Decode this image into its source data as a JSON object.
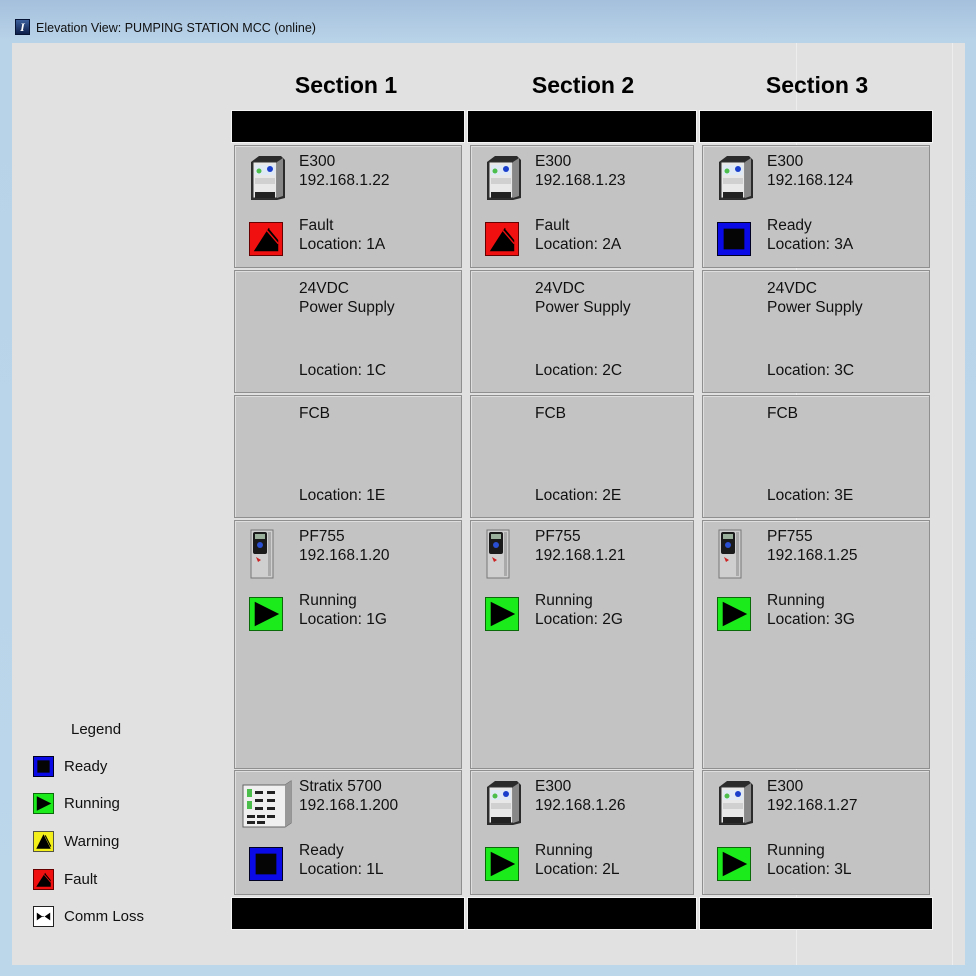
{
  "window": {
    "title": "Elevation View: PUMPING STATION MCC (online)",
    "app_icon": "factorytalk-icon"
  },
  "colors": {
    "fault": "#f01010",
    "ready": "#0a0ae6",
    "running": "#1bea1b",
    "warning": "#f2ef1a",
    "comm_loss": "#ffffff",
    "cell_bg": "#c3c3c3",
    "panel_bg": "#e1e1e1"
  },
  "sections": [
    {
      "title": "Section 1",
      "cells": [
        {
          "device": "E300",
          "address": "192.168.1.22",
          "status": "Fault",
          "location": "Location: 1A",
          "icon": "e300-overload-relay-icon"
        },
        {
          "line1": "24VDC",
          "line2": "Power Supply",
          "location": "Location: 1C"
        },
        {
          "line1": "FCB",
          "location": "Location: 1E"
        },
        {
          "device": "PF755",
          "address": "192.168.1.20",
          "status": "Running",
          "location": "Location: 1G",
          "icon": "powerflex-755-drive-icon"
        },
        {
          "device": "Stratix 5700",
          "address": "192.168.1.200",
          "status": "Ready",
          "location": "Location: 1L",
          "icon": "stratix-switch-icon"
        }
      ]
    },
    {
      "title": "Section 2",
      "cells": [
        {
          "device": "E300",
          "address": "192.168.1.23",
          "status": "Fault",
          "location": "Location: 2A",
          "icon": "e300-overload-relay-icon"
        },
        {
          "line1": "24VDC",
          "line2": "Power Supply",
          "location": "Location: 2C"
        },
        {
          "line1": "FCB",
          "location": "Location: 2E"
        },
        {
          "device": "PF755",
          "address": "192.168.1.21",
          "status": "Running",
          "location": "Location: 2G",
          "icon": "powerflex-755-drive-icon"
        },
        {
          "device": "E300",
          "address": "192.168.1.26",
          "status": "Running",
          "location": "Location: 2L",
          "icon": "e300-overload-relay-icon"
        }
      ]
    },
    {
      "title": "Section 3",
      "cells": [
        {
          "device": "E300",
          "address": "192.168.124",
          "status": "Ready",
          "location": "Location: 3A",
          "icon": "e300-overload-relay-icon"
        },
        {
          "line1": "24VDC",
          "line2": "Power Supply",
          "location": "Location: 3C"
        },
        {
          "line1": "FCB",
          "location": "Location: 3E"
        },
        {
          "device": "PF755",
          "address": "192.168.1.25",
          "status": "Running",
          "location": "Location: 3G",
          "icon": "powerflex-755-drive-icon"
        },
        {
          "device": "E300",
          "address": "192.168.1.27",
          "status": "Running",
          "location": "Location: 3L",
          "icon": "e300-overload-relay-icon"
        }
      ]
    }
  ],
  "legend": {
    "title": "Legend",
    "items": [
      {
        "label": "Ready",
        "icon": "ready-stop-icon"
      },
      {
        "label": "Running",
        "icon": "running-play-icon"
      },
      {
        "label": "Warning",
        "icon": "warning-icon"
      },
      {
        "label": "Fault",
        "icon": "fault-icon"
      },
      {
        "label": "Comm Loss",
        "icon": "comm-loss-icon"
      }
    ]
  }
}
